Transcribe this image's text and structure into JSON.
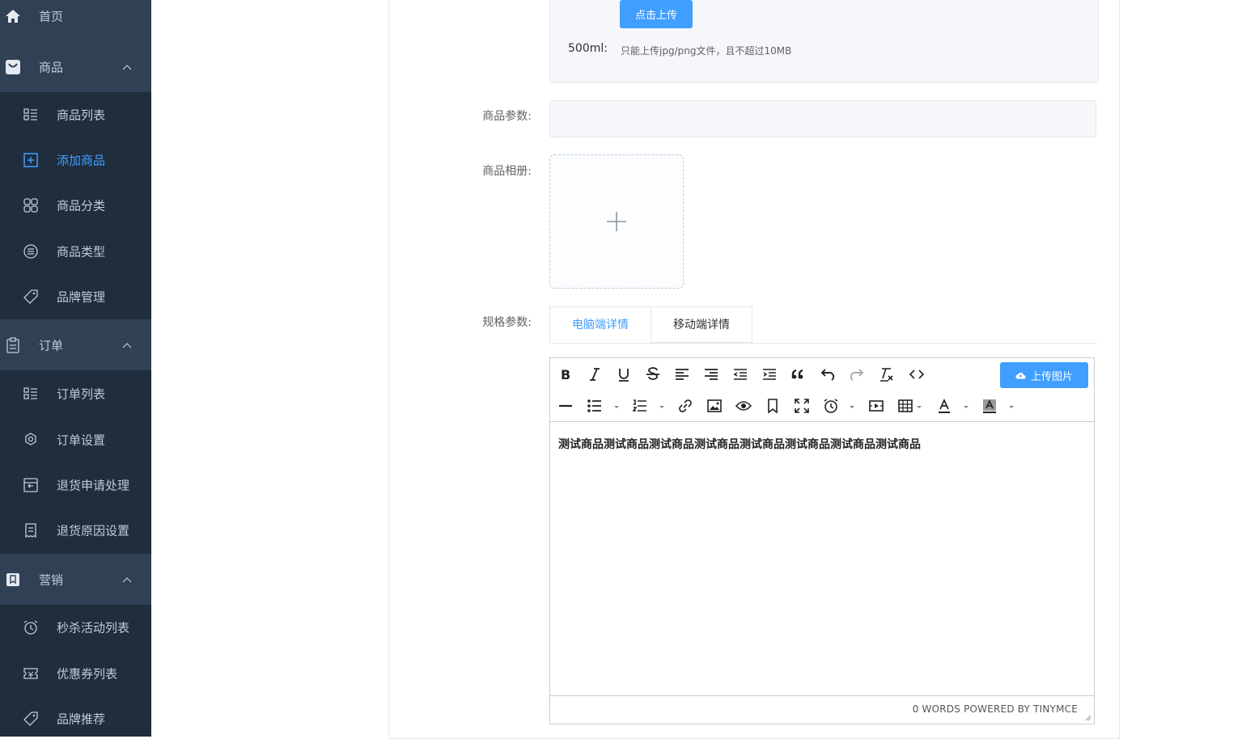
{
  "sidebar": {
    "groups": {
      "home": {
        "label": "首页",
        "icon": "home-icon"
      },
      "product": {
        "label": "商品",
        "icon": "shopping-bag-icon"
      },
      "order": {
        "label": "订单",
        "icon": "clipboard-icon"
      },
      "marketing": {
        "label": "营销",
        "icon": "bookmark-icon"
      }
    },
    "items": {
      "product_list": {
        "label": "商品列表",
        "icon": "list-icon"
      },
      "add_product": {
        "label": "添加商品",
        "icon": "add-square-icon",
        "active": true
      },
      "product_category": {
        "label": "商品分类",
        "icon": "grid-icon"
      },
      "product_type": {
        "label": "商品类型",
        "icon": "lines-circle-icon"
      },
      "brand_manage": {
        "label": "品牌管理",
        "icon": "tag-icon"
      },
      "order_list": {
        "label": "订单列表",
        "icon": "list-icon"
      },
      "order_settings": {
        "label": "订单设置",
        "icon": "gear-icon"
      },
      "return_apply": {
        "label": "退货申请处理",
        "icon": "return-box-icon"
      },
      "return_reason": {
        "label": "退货原因设置",
        "icon": "receipt-icon"
      },
      "flash_sale": {
        "label": "秒杀活动列表",
        "icon": "alarm-clock-icon"
      },
      "coupon_list": {
        "label": "优惠券列表",
        "icon": "ticket-icon"
      },
      "brand_recommend": {
        "label": "品牌推荐",
        "icon": "tag-icon"
      }
    }
  },
  "upload": {
    "button_label": "点击上传",
    "size_label": "500ml:",
    "tip": "只能上传jpg/png文件，且不超过10MB"
  },
  "form": {
    "params_label": "商品参数:",
    "album_label": "商品相册:",
    "spec_label": "规格参数:",
    "params_value": ""
  },
  "tabs": {
    "pc": "电脑端详情",
    "mobile": "移动端详情",
    "active": "pc"
  },
  "editor": {
    "upload_image_label": "上传图片",
    "content": "测试商品测试商品测试商品测试商品测试商品测试商品测试商品测试商品",
    "status": "0 WORDS POWERED BY TINYMCE"
  },
  "colors": {
    "sidebar_bg": "#1f2d3d",
    "sidebar_group_bg": "#304156",
    "sidebar_text": "#bfcbd9",
    "accent": "#409eff"
  }
}
